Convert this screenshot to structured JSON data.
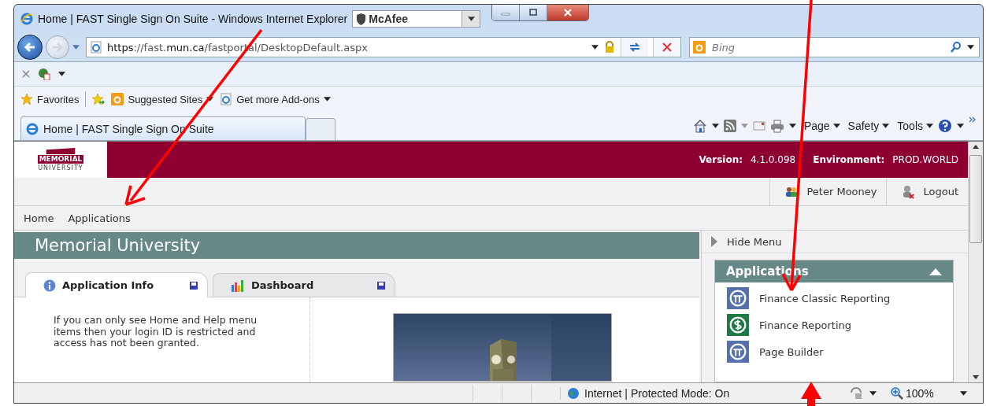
{
  "window": {
    "title": "Home | FAST Single Sign On Suite - Windows Internet Explorer"
  },
  "toolbar_brand": {
    "label": "McAfee"
  },
  "address_bar": {
    "scheme": "https",
    "host_prefix": "://fast.",
    "domain": "mun.ca",
    "path": "/fastportal/DesktopDefault.aspx"
  },
  "search": {
    "placeholder": "Bing"
  },
  "favorites_bar": [
    {
      "label": "Favorites",
      "kind": "star"
    },
    {
      "label": "Suggested Sites",
      "kind": "bing"
    },
    {
      "label": "Get more Add-ons",
      "kind": "ie"
    }
  ],
  "tabs": [
    {
      "label": "Home | FAST Single Sign On Suite",
      "selected": true
    }
  ],
  "command_bar": [
    "Page",
    "Safety",
    "Tools"
  ],
  "page": {
    "logo": {
      "line1": "MEMORIAL",
      "line2": "UNIVERSITY"
    },
    "version_label": "Version:",
    "version": "4.1.0.098",
    "environment_label": "Environment:",
    "environment": "PROD.WORLD",
    "user": "Peter Mooney",
    "logout": "Logout",
    "nav": [
      "Home",
      "Applications"
    ],
    "title": "Memorial University",
    "content_tabs": [
      {
        "label": "Application Info",
        "selected": true,
        "kind": "info"
      },
      {
        "label": "Dashboard",
        "selected": false,
        "kind": "chart"
      }
    ],
    "info_text": "If you can only see Home and Help menu items then your login ID is restricted and access has not been granted.",
    "hide_menu": "Hide Menu",
    "applications": {
      "title": "Applications",
      "expanded": true,
      "items": [
        {
          "label": "Finance Classic Reporting",
          "kind": "portal"
        },
        {
          "label": "Finance Reporting",
          "kind": "dollar"
        },
        {
          "label": "Page Builder",
          "kind": "portal"
        }
      ]
    }
  },
  "status_bar": {
    "zone": "Internet | Protected Mode: On",
    "zoom": "100%"
  }
}
